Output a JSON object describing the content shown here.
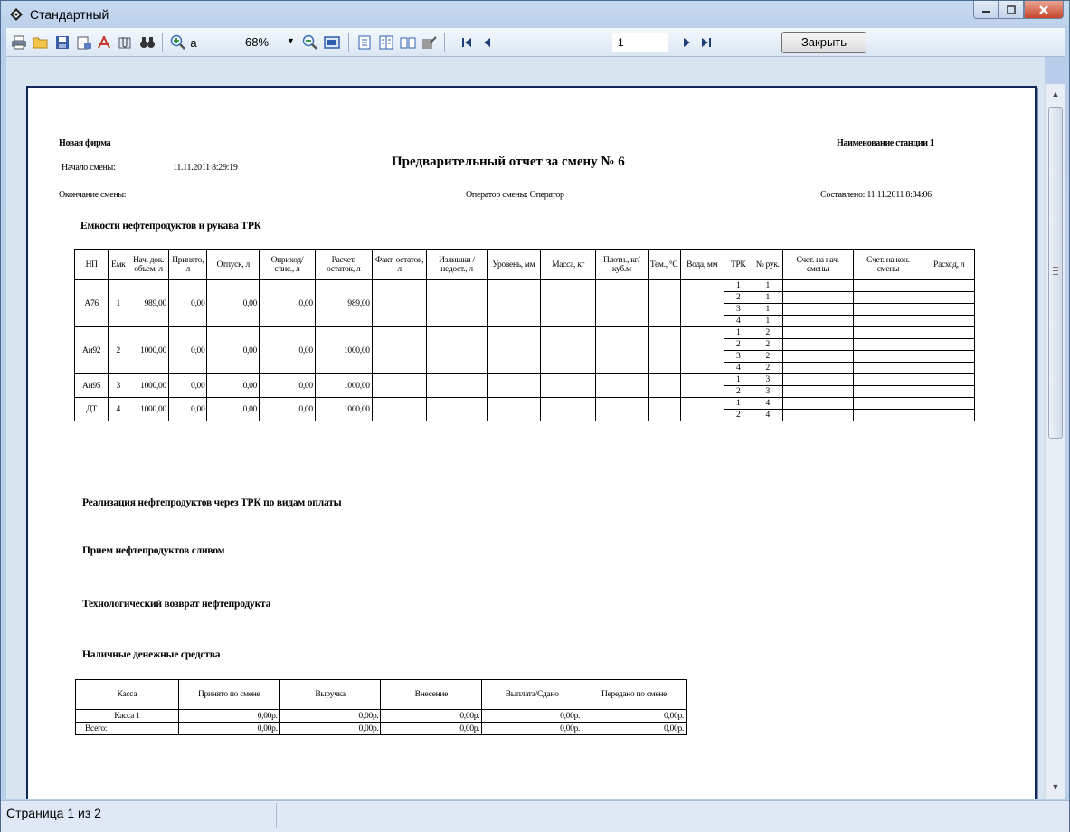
{
  "window": {
    "title": "Стандартный"
  },
  "toolbar": {
    "zoom": "68%",
    "page_value": "1",
    "close_label": "Закрыть"
  },
  "status": {
    "text": "Страница 1 из 2"
  },
  "report": {
    "company": "Новая фирма",
    "station": "Наименование станции 1",
    "title": "Предварительный отчет за смену № 6",
    "shift_start_label": "Начало смены:",
    "shift_start": "11.11.2011 8:29:19",
    "shift_end_label": "Окончание смены:",
    "operator": "Оператор смены: Оператор",
    "composed": "Составлено: 11.11.2011 8:34:06",
    "sections": {
      "tanks": "Емкости нефтепродуктов и рукава ТРК",
      "sales": "Реализация нефтепродуктов через ТРК по видам оплаты",
      "intake": "Прием нефтепродуктов сливом",
      "return": "Технологический возврат нефтепродукта",
      "cash": "Наличные денежные средства"
    },
    "tank_headers": [
      "НП",
      "Емк",
      "Нач. док. объем, л",
      "Принято, л",
      "Отпуск, л",
      "Оприход/ спис., л",
      "Расчет. остаток, л",
      "Факт. остаток, л",
      "Излишки /недост., л",
      "Уровень, мм",
      "Масса, кг",
      "Плотн., кг/куб.м",
      "Тем., °С",
      "Вода, мм",
      "ТРК",
      "№ рук.",
      "Счет. на нач. смены",
      "Счет. на кон. смены",
      "Расход, л"
    ],
    "tanks": [
      {
        "np": "А76",
        "tank": "1",
        "start": "989,00",
        "received": "0,00",
        "issued": "0,00",
        "adj": "0,00",
        "calc": "989,00",
        "hoses": [
          [
            "1",
            "1"
          ],
          [
            "2",
            "1"
          ],
          [
            "3",
            "1"
          ],
          [
            "4",
            "1"
          ]
        ]
      },
      {
        "np": "Аи92",
        "tank": "2",
        "start": "1000,00",
        "received": "0,00",
        "issued": "0,00",
        "adj": "0,00",
        "calc": "1000,00",
        "hoses": [
          [
            "1",
            "2"
          ],
          [
            "2",
            "2"
          ],
          [
            "3",
            "2"
          ],
          [
            "4",
            "2"
          ]
        ]
      },
      {
        "np": "Аи95",
        "tank": "3",
        "start": "1000,00",
        "received": "0,00",
        "issued": "0,00",
        "adj": "0,00",
        "calc": "1000,00",
        "hoses": [
          [
            "1",
            "3"
          ],
          [
            "2",
            "3"
          ]
        ]
      },
      {
        "np": "ДТ",
        "tank": "4",
        "start": "1000,00",
        "received": "0,00",
        "issued": "0,00",
        "adj": "0,00",
        "calc": "1000,00",
        "hoses": [
          [
            "1",
            "4"
          ],
          [
            "2",
            "4"
          ]
        ]
      }
    ],
    "cash_headers": [
      "Касса",
      "Принято по смене",
      "Выручка",
      "Внесение",
      "Выплата/Сдано",
      "Передано по смене"
    ],
    "cash_rows": [
      {
        "name": "Касса 1",
        "values": [
          "0,00р.",
          "0,00р.",
          "0,00р.",
          "0,00р.",
          "0,00р."
        ],
        "bold": false
      },
      {
        "name": "Всего:",
        "values": [
          "0,00р.",
          "0,00р.",
          "0,00р.",
          "0,00р.",
          "0,00р."
        ],
        "bold": true
      }
    ]
  }
}
